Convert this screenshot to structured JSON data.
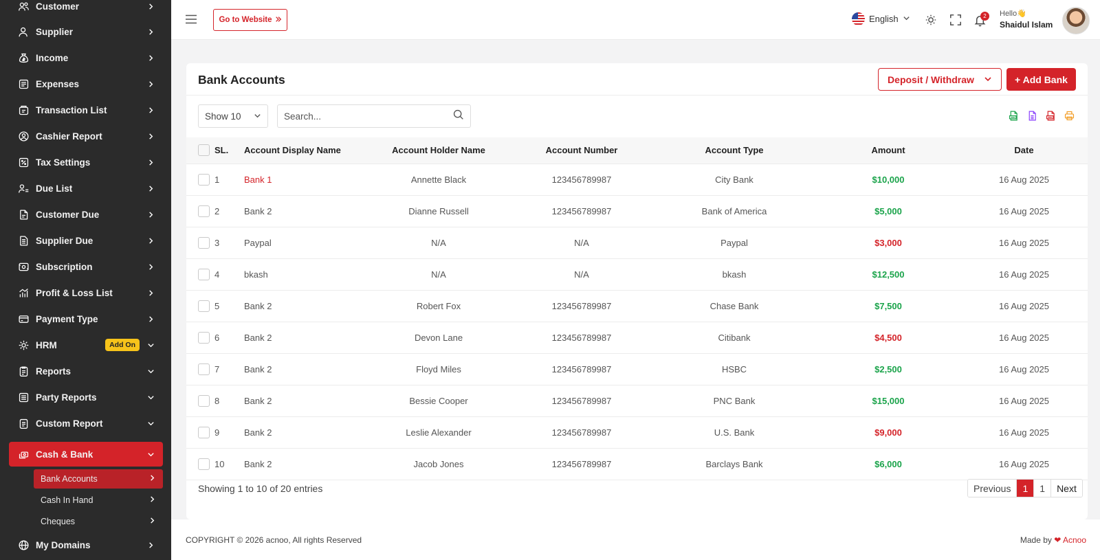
{
  "sidebar": {
    "items": [
      {
        "label": "Customer",
        "icon": "customers-icon"
      },
      {
        "label": "Supplier",
        "icon": "supplier-icon"
      },
      {
        "label": "Income",
        "icon": "income-icon"
      },
      {
        "label": "Expenses",
        "icon": "expenses-icon"
      },
      {
        "label": "Transaction List",
        "icon": "transaction-icon"
      },
      {
        "label": "Cashier Report",
        "icon": "cashier-icon"
      },
      {
        "label": "Tax Settings",
        "icon": "tax-icon"
      },
      {
        "label": "Due List",
        "icon": "due-list-icon"
      },
      {
        "label": "Customer Due",
        "icon": "customer-due-icon"
      },
      {
        "label": "Supplier Due",
        "icon": "supplier-due-icon"
      },
      {
        "label": "Subscription",
        "icon": "subscription-icon"
      },
      {
        "label": "Profit & Loss List",
        "icon": "profit-loss-icon"
      },
      {
        "label": "Payment Type",
        "icon": "payment-type-icon"
      },
      {
        "label": "HRM",
        "icon": "hrm-icon",
        "badge": "Add On"
      },
      {
        "label": "Reports",
        "icon": "reports-icon"
      },
      {
        "label": "Party Reports",
        "icon": "party-reports-icon"
      },
      {
        "label": "Custom Report",
        "icon": "custom-report-icon"
      },
      {
        "label": "Cash & Bank",
        "icon": "cash-bank-icon"
      }
    ],
    "sub_items": [
      {
        "label": "Bank Accounts"
      },
      {
        "label": "Cash In Hand"
      },
      {
        "label": "Cheques"
      }
    ],
    "last_item": {
      "label": "My Domains",
      "icon": "globe-icon"
    }
  },
  "header": {
    "website_button": "Go to Website",
    "language": "English",
    "notification_count": "2",
    "greeting": "Hello👋",
    "user_name": "Shaidul Islam"
  },
  "card": {
    "title": "Bank Accounts",
    "deposit_withdraw": "Deposit / Withdraw",
    "add_bank": "+ Add Bank",
    "show_select": "Show 10",
    "search_placeholder": "Search..."
  },
  "table": {
    "headers": {
      "sl": "SL.",
      "display_name": "Account Display Name",
      "holder": "Account Holder Name",
      "number": "Account Number",
      "type": "Account Type",
      "amount": "Amount",
      "date": "Date"
    },
    "rows": [
      {
        "sl": "1",
        "display_name": "Bank 1",
        "holder": "Annette Black",
        "number": "123456789987",
        "type": "City Bank",
        "amount": "$10,000",
        "date": "16 Aug 2025"
      },
      {
        "sl": "2",
        "display_name": "Bank 2",
        "holder": "Dianne Russell",
        "number": "123456789987",
        "type": "Bank of America",
        "amount": "$5,000",
        "date": "16 Aug 2025"
      },
      {
        "sl": "3",
        "display_name": "Paypal",
        "holder": "N/A",
        "number": "N/A",
        "type": "Paypal",
        "amount": "$3,000",
        "date": "16 Aug 2025"
      },
      {
        "sl": "4",
        "display_name": "bkash",
        "holder": "N/A",
        "number": "N/A",
        "type": "bkash",
        "amount": "$12,500",
        "date": "16 Aug 2025"
      },
      {
        "sl": "5",
        "display_name": "Bank 2",
        "holder": "Robert Fox",
        "number": "123456789987",
        "type": "Chase Bank",
        "amount": "$7,500",
        "date": "16 Aug 2025"
      },
      {
        "sl": "6",
        "display_name": "Bank 2",
        "holder": "Devon Lane",
        "number": "123456789987",
        "type": "Citibank",
        "amount": "$4,500",
        "date": "16 Aug 2025"
      },
      {
        "sl": "7",
        "display_name": "Bank 2",
        "holder": "Floyd Miles",
        "number": "123456789987",
        "type": "HSBC",
        "amount": "$2,500",
        "date": "16 Aug 2025"
      },
      {
        "sl": "8",
        "display_name": "Bank 2",
        "holder": "Bessie Cooper",
        "number": "123456789987",
        "type": "PNC Bank",
        "amount": "$15,000",
        "date": "16 Aug 2025"
      },
      {
        "sl": "9",
        "display_name": "Bank 2",
        "holder": "Leslie Alexander",
        "number": "123456789987",
        "type": "U.S. Bank",
        "amount": "$9,000",
        "date": "16 Aug 2025"
      },
      {
        "sl": "10",
        "display_name": "Bank 2",
        "holder": "Jacob Jones",
        "number": "123456789987",
        "type": "Barclays Bank",
        "amount": "$6,000",
        "date": "16 Aug 2025"
      }
    ]
  },
  "pagination": {
    "showing": "Showing 1 to 10 of 20 entries",
    "previous": "Previous",
    "current": "1",
    "page": "1",
    "next": "Next"
  },
  "footer": {
    "copyright": "COPYRIGHT © 2026 acnoo, All rights Reserved",
    "made_by": "Made by",
    "brand": "Acnoo"
  },
  "colors": {
    "accent": "#d42329",
    "positive": "#1aa34a",
    "sidebar_bg": "#2b2b2b",
    "badge": "#f7c31a"
  }
}
